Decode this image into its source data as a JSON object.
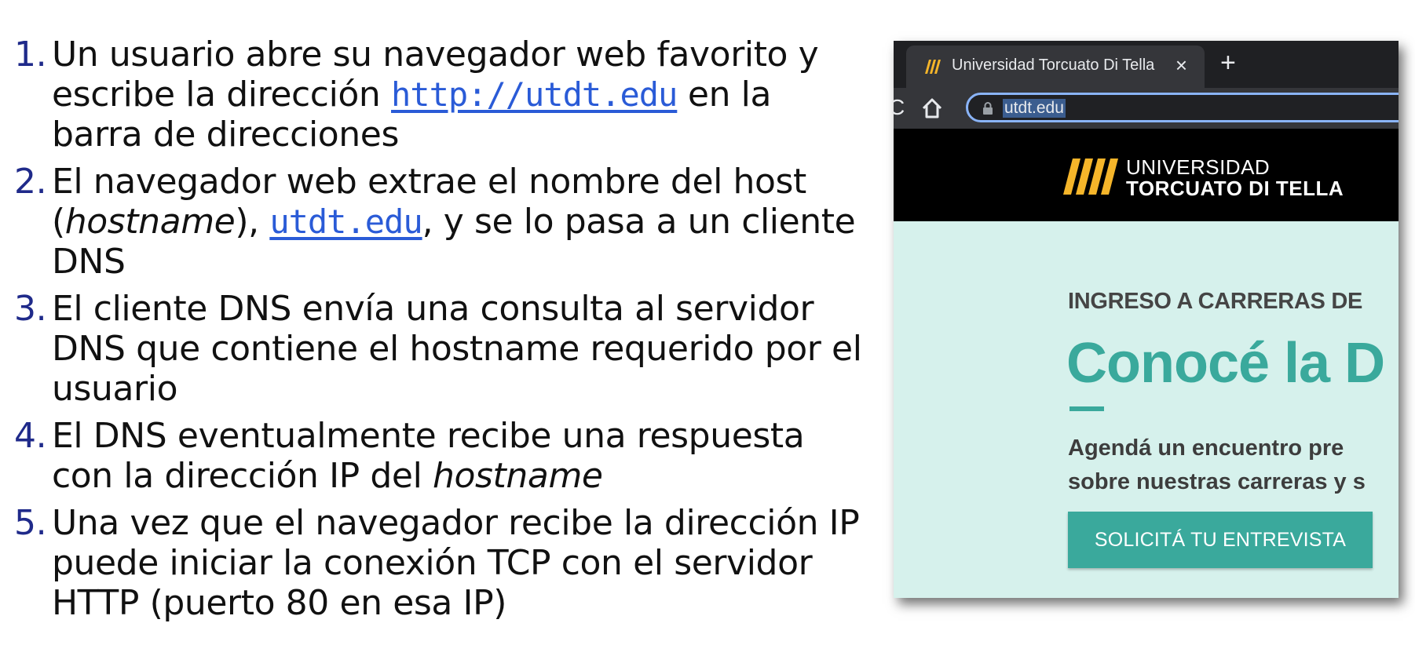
{
  "steps": [
    {
      "number": "1.",
      "parts": [
        "Un usuario abre su navegador web favorito y escribe la dirección ",
        "http://utdt.edu",
        " en la barra de direcciones"
      ]
    },
    {
      "number": "2.",
      "parts": [
        "El navegador web extrae el nombre del host (",
        "hostname",
        "), ",
        "utdt.edu",
        ",  y se lo pasa a un cliente DNS"
      ]
    },
    {
      "number": "3.",
      "parts": [
        "El cliente DNS envía una consulta al servidor DNS que contiene el hostname requerido por el usuario"
      ]
    },
    {
      "number": "4.",
      "parts": [
        "El DNS eventualmente recibe una respuesta con la dirección IP del ",
        "hostname"
      ]
    },
    {
      "number": "5.",
      "parts": [
        "Una vez que el navegador recibe la dirección IP puede iniciar la conexión TCP con el servidor HTTP (puerto 80 en esa IP)"
      ]
    }
  ],
  "browser": {
    "tab_title": "Universidad Torcuato Di Tella",
    "tab_close": "×",
    "new_tab": "+",
    "reload": "C",
    "url": "utdt.edu",
    "favicon": "utdt-stripes-icon"
  },
  "site": {
    "logo_line1": "UNIVERSIDAD",
    "logo_line2": "TORCUATO DI TELLA",
    "logo_color": "#f5b52a",
    "kicker": "INGRESO A CARRERAS DE",
    "headline": "Conocé la D",
    "body_line1": "Agendá un encuentro pre",
    "body_line2": "sobre nuestras carreras y s",
    "cta_label": "SOLICITÁ TU ENTREVISTA",
    "accent_color": "#3aa99c",
    "hero_bg": "#d6f1ec"
  }
}
